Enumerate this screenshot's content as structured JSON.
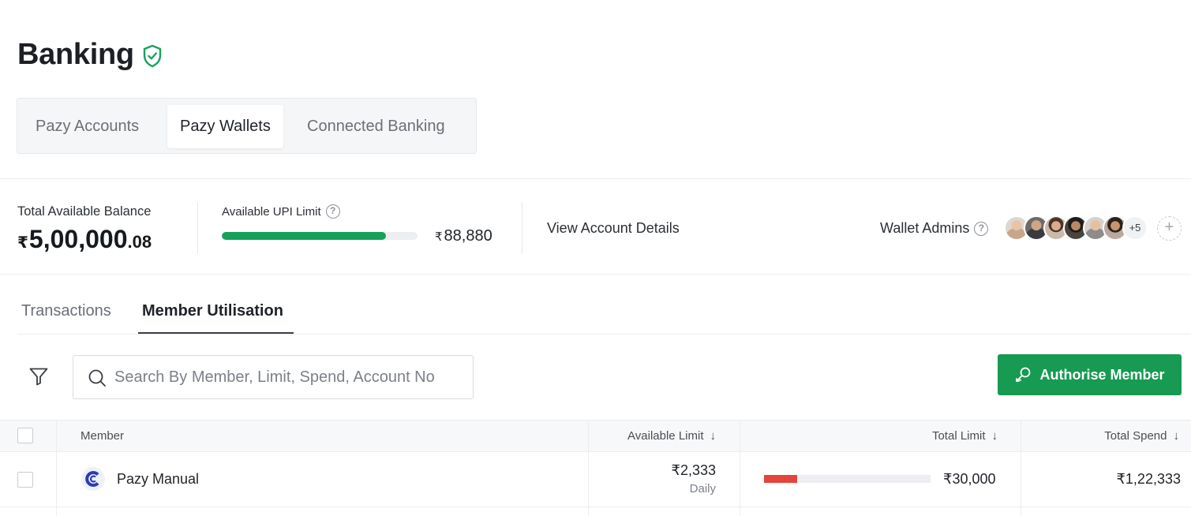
{
  "page": {
    "title": "Banking"
  },
  "bank_tabs": [
    "Pazy Accounts",
    "Pazy Wallets",
    "Connected Banking"
  ],
  "summary": {
    "balance_label": "Total Available Balance",
    "balance_currency": "₹",
    "balance_main": "5,00,000",
    "balance_decimal": ".08",
    "upi_label": "Available UPI Limit",
    "upi_fill_fraction": 0.84,
    "upi_currency": "₹",
    "upi_value": "88,880",
    "view_details": "View Account Details",
    "admins_label": "Wallet Admins",
    "admins_more": "+5",
    "add_symbol": "+"
  },
  "subtabs": [
    "Transactions",
    "Member Utilisation"
  ],
  "search": {
    "placeholder": "Search By Member, Limit, Spend, Account No"
  },
  "authorise_button": "Authorise Member",
  "table": {
    "headers": {
      "member": "Member",
      "available_limit": "Available Limit",
      "total_limit": "Total Limit",
      "total_spend": "Total Spend"
    },
    "sort_symbol": "↓",
    "rows": [
      {
        "member": "Pazy Manual",
        "available_limit": "₹2,333",
        "period": "Daily",
        "limit_used_fraction": 0.2,
        "total_limit": "₹30,000",
        "total_spend": "₹1,22,333"
      }
    ]
  },
  "colors": {
    "accent_green": "#179a52",
    "upi_bar": "#17a05a",
    "limit_bar": "#e5443a"
  },
  "icons": [
    "shield-check-icon",
    "help-icon",
    "filter-icon",
    "search-icon",
    "key-icon",
    "plus-icon",
    "sort-down-icon"
  ]
}
